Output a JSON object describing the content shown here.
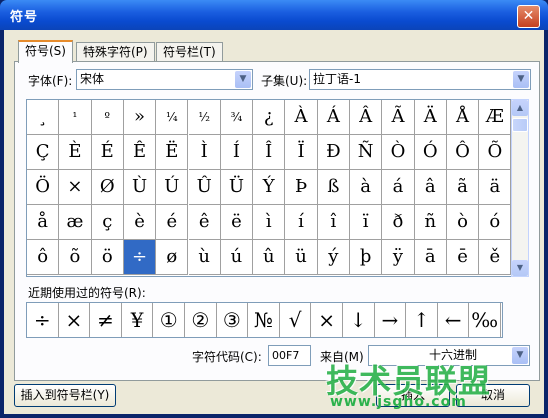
{
  "window": {
    "title": "符号",
    "close_glyph": "✕"
  },
  "tabs": [
    {
      "label": "符号(S)",
      "active": true
    },
    {
      "label": "特殊字符(P)",
      "active": false
    },
    {
      "label": "符号栏(T)",
      "active": false
    }
  ],
  "font": {
    "label": "字体(F):",
    "value": "宋体"
  },
  "subset": {
    "label": "子集(U):",
    "value": "拉丁语-1"
  },
  "symbols": [
    [
      "¸",
      "¹",
      "º",
      "»",
      "¼",
      "½",
      "¾",
      "¿",
      "À",
      "Á",
      "Â",
      "Ã",
      "Ä",
      "Å",
      "Æ"
    ],
    [
      "Ç",
      "È",
      "É",
      "Ê",
      "Ë",
      "Ì",
      "Í",
      "Î",
      "Ï",
      "Ð",
      "Ñ",
      "Ò",
      "Ó",
      "Ô",
      "Õ"
    ],
    [
      "Ö",
      "×",
      "Ø",
      "Ù",
      "Ú",
      "Û",
      "Ü",
      "Ý",
      "Þ",
      "ß",
      "à",
      "á",
      "â",
      "ã",
      "ä"
    ],
    [
      "å",
      "æ",
      "ç",
      "è",
      "é",
      "ê",
      "ë",
      "ì",
      "í",
      "î",
      "ï",
      "ð",
      "ñ",
      "ò",
      "ó"
    ],
    [
      "ô",
      "õ",
      "ö",
      "÷",
      "ø",
      "ù",
      "ú",
      "û",
      "ü",
      "ý",
      "þ",
      "ÿ",
      "ā",
      "ē",
      "ě"
    ]
  ],
  "selected_symbol": "÷",
  "recent": {
    "label": "近期使用过的符号(R):",
    "items": [
      "÷",
      "×",
      "≠",
      "¥",
      "①",
      "②",
      "③",
      "№",
      "√",
      "×",
      "↓",
      "→",
      "↑",
      "←",
      "‰"
    ]
  },
  "char_code": {
    "label": "字符代码(C):",
    "value": "00F7"
  },
  "from": {
    "label": "来自(M)",
    "value": "十六进制"
  },
  "buttons": {
    "insert_to_bar": "插入到符号栏(Y)",
    "insert": "插入",
    "cancel": "取消"
  },
  "watermark": {
    "line1": "技术员联盟",
    "line2": "www.jsgho.com"
  },
  "colors": {
    "titlebar": "#0a4bd0",
    "selection": "#316ac5",
    "watermark": "#2bb24c"
  }
}
